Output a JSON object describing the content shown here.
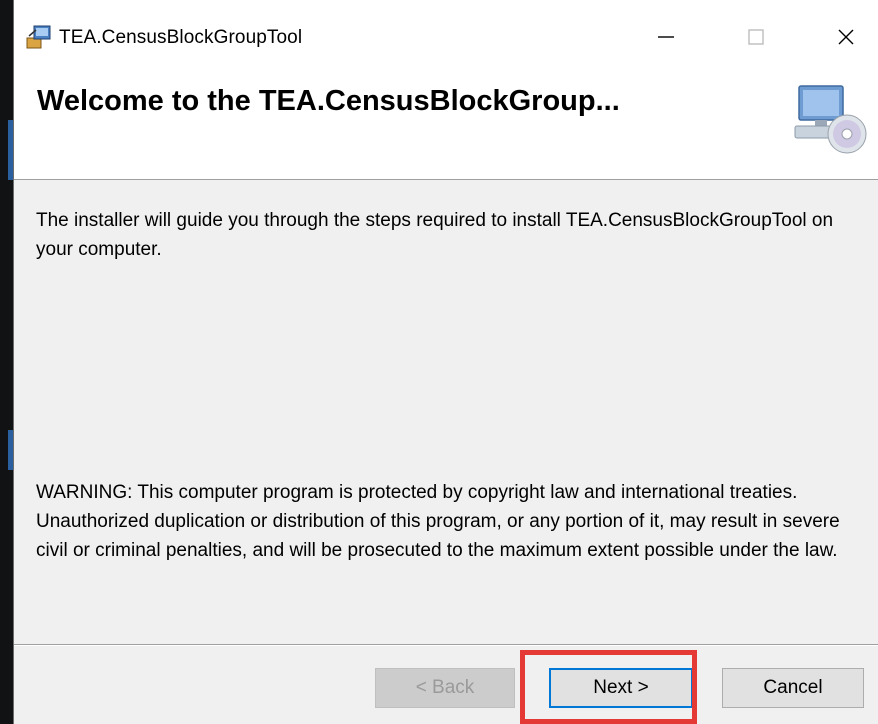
{
  "window": {
    "title": "TEA.CensusBlockGroupTool",
    "controls": {
      "minimize": "—",
      "maximize": "☐",
      "close": "✕"
    }
  },
  "banner": {
    "heading": "Welcome to the TEA.CensusBlockGroup...",
    "icon": "computer-disc-icon"
  },
  "content": {
    "intro": "The installer will guide you through the steps required to install TEA.CensusBlockGroupTool on your computer.",
    "warning": "WARNING: This computer program is protected by copyright law and international treaties. Unauthorized duplication or distribution of this program, or any portion of it, may result in severe civil or criminal penalties, and will be prosecuted to the maximum extent possible under the law."
  },
  "buttons": {
    "back": "< Back",
    "next": "Next >",
    "cancel": "Cancel"
  },
  "colors": {
    "focus_border": "#0078d7",
    "highlight": "#e53935"
  }
}
